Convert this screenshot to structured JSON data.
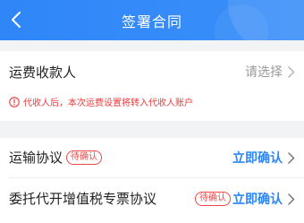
{
  "header": {
    "title": "签署合同",
    "back_icon": "chevron-left-icon",
    "color": "#2f86f7"
  },
  "payee": {
    "label": "运费收款人",
    "placeholder": "请选择",
    "notice": "代收人后，本次运费设置将转入代收人账户",
    "notice_color": "#ea3b3b"
  },
  "contracts": [
    {
      "label": "运输协议",
      "badge": "待确认",
      "action": "立即确认"
    },
    {
      "label": "委托代开增值税专票协议",
      "badge": "待确认",
      "action": "立即确认"
    }
  ]
}
